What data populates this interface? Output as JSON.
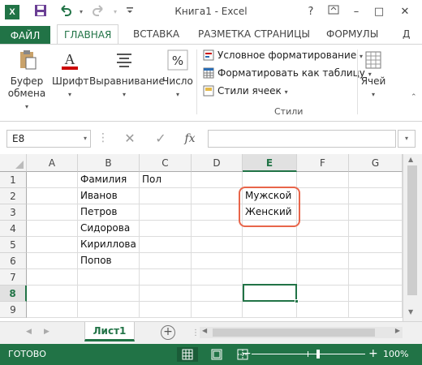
{
  "app": {
    "logo": "X",
    "title": "Книга1 - Excel"
  },
  "title_buttons": {
    "help": "?",
    "minimize": "–",
    "maximize": "□",
    "close": "✕"
  },
  "ribbon_tabs": [
    {
      "label": "ФАЙЛ"
    },
    {
      "label": "ГЛАВНАЯ",
      "active": true
    },
    {
      "label": "ВСТАВКА"
    },
    {
      "label": "РАЗМЕТКА СТРАНИЦЫ"
    },
    {
      "label": "ФОРМУЛЫ"
    },
    {
      "label": "Д"
    }
  ],
  "ribbon": {
    "clipboard": {
      "line1": "Буфер",
      "line2": "обмена"
    },
    "font": {
      "label": "Шрифт"
    },
    "alignment": {
      "label": "Выравнивание"
    },
    "number": {
      "label": "Число"
    },
    "styles": {
      "conditional": "Условное форматирование",
      "format_table": "Форматировать как таблицу",
      "cell_styles": "Стили ячеек",
      "caption": "Стили"
    },
    "cells": {
      "label": "Ячей"
    }
  },
  "formula_bar": {
    "name_box": "E8",
    "fx": "fx",
    "value": ""
  },
  "sheet": {
    "columns": [
      "A",
      "B",
      "C",
      "D",
      "E",
      "F",
      "G"
    ],
    "selected_column": "E",
    "rows": [
      "1",
      "2",
      "3",
      "4",
      "5",
      "6",
      "7",
      "8",
      "9"
    ],
    "selected_row": "8",
    "cells": {
      "B1": "Фамилия",
      "C1": "Пол",
      "B2": "Иванов",
      "B3": "Петров",
      "B4": "Сидорова",
      "B5": "Кириллова",
      "B6": "Попов",
      "E2": "Мужской",
      "E3": "Женский"
    }
  },
  "sheet_tabs": {
    "active": "Лист1",
    "add": "+"
  },
  "status_bar": {
    "state": "ГОТОВО",
    "zoom": "100%",
    "zoom_minus": "−",
    "zoom_plus": "+"
  },
  "colors": {
    "accent": "#217346",
    "highlight": "#e8654a"
  }
}
